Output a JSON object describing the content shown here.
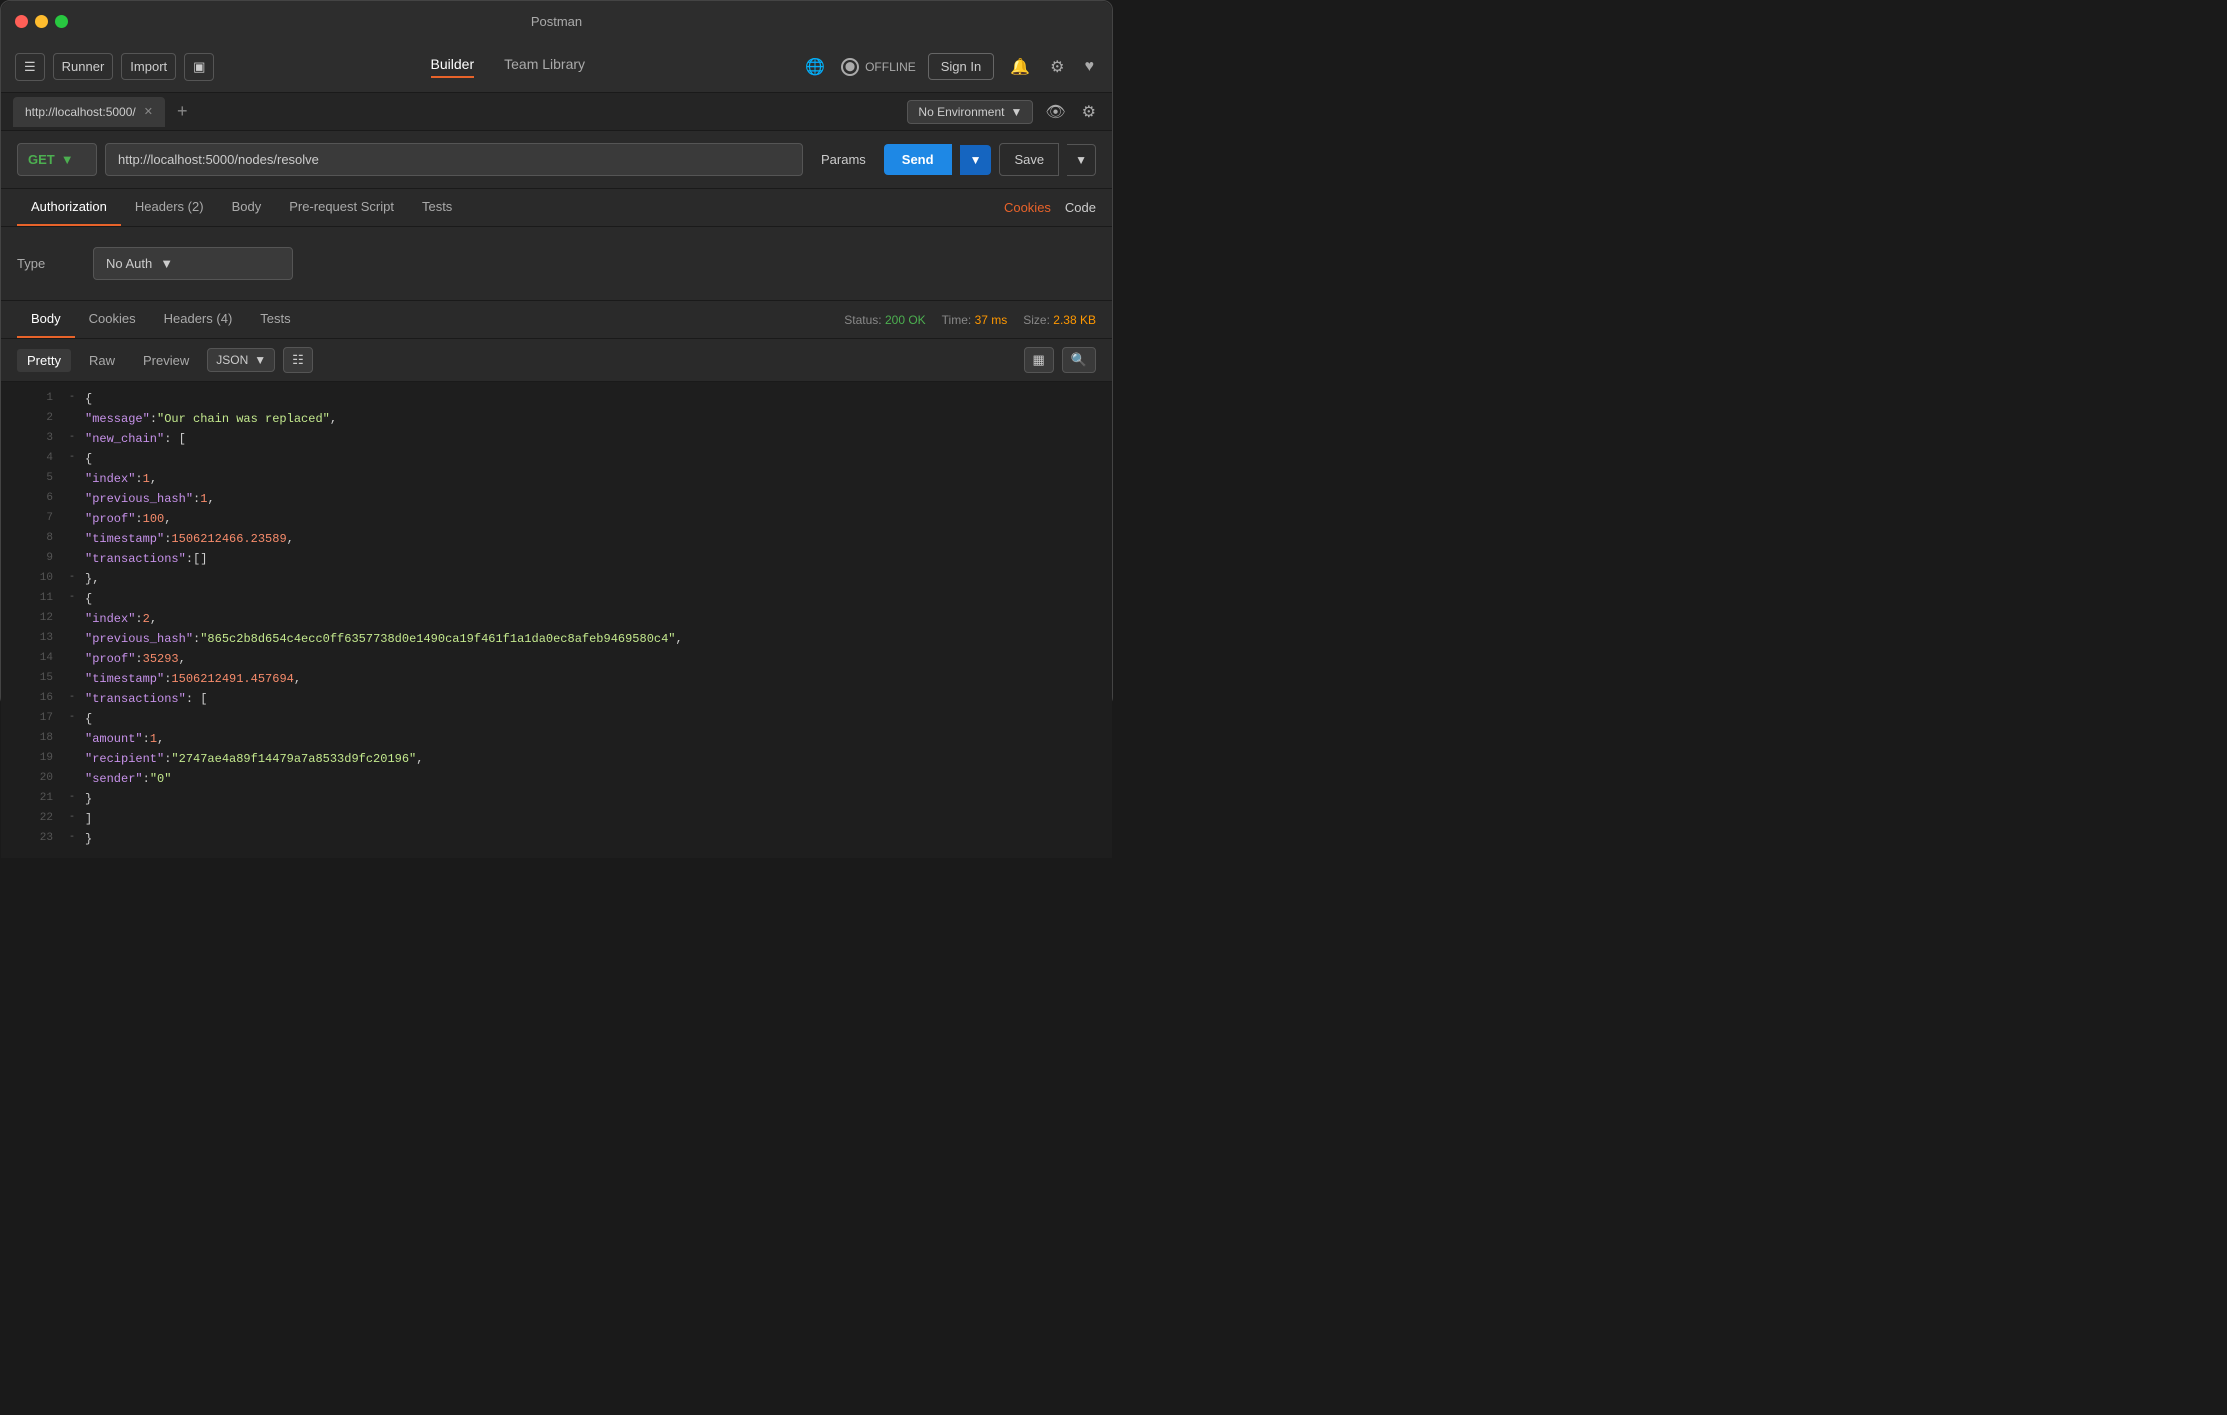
{
  "titlebar": {
    "title": "Postman"
  },
  "toolbar": {
    "runner_label": "Runner",
    "import_label": "Import",
    "builder_tab": "Builder",
    "team_library_tab": "Team Library",
    "offline_label": "OFFLINE",
    "sign_in_label": "Sign In"
  },
  "tab_bar": {
    "tab_url": "http://localhost:5000/",
    "no_environment": "No Environment",
    "chevron": "▾"
  },
  "request": {
    "method": "GET",
    "url": "http://localhost:5000/nodes/resolve",
    "params_label": "Params",
    "send_label": "Send",
    "save_label": "Save"
  },
  "req_tabs": {
    "authorization": "Authorization",
    "headers": "Headers",
    "headers_count": "2",
    "body": "Body",
    "pre_request": "Pre-request Script",
    "tests": "Tests",
    "cookies": "Cookies",
    "code": "Code"
  },
  "auth": {
    "type_label": "Type",
    "no_auth": "No Auth"
  },
  "response": {
    "body_tab": "Body",
    "cookies_tab": "Cookies",
    "headers_tab": "Headers",
    "headers_count": "4",
    "tests_tab": "Tests",
    "status_label": "Status:",
    "status_value": "200 OK",
    "time_label": "Time:",
    "time_value": "37 ms",
    "size_label": "Size:",
    "size_value": "2.38 KB",
    "pretty_tab": "Pretty",
    "raw_tab": "Raw",
    "preview_tab": "Preview",
    "format": "JSON"
  },
  "json_lines": [
    {
      "num": 1,
      "collapse": "-",
      "content": [
        {
          "type": "brace",
          "text": "{"
        }
      ]
    },
    {
      "num": 2,
      "collapse": "",
      "content": [
        {
          "type": "key",
          "text": "  \"message\""
        },
        {
          "type": "punct",
          "text": ": "
        },
        {
          "type": "str",
          "text": "\"Our chain was replaced\""
        },
        {
          "type": "punct",
          "text": ","
        }
      ]
    },
    {
      "num": 3,
      "collapse": "-",
      "content": [
        {
          "type": "key",
          "text": "  \"new_chain\""
        },
        {
          "type": "punct",
          "text": ": ["
        },
        {
          "type": "brace",
          "text": ""
        }
      ]
    },
    {
      "num": 4,
      "collapse": "-",
      "content": [
        {
          "type": "brace",
          "text": "    {"
        }
      ]
    },
    {
      "num": 5,
      "collapse": "",
      "content": [
        {
          "type": "key",
          "text": "      \"index\""
        },
        {
          "type": "punct",
          "text": ": "
        },
        {
          "type": "num",
          "text": "1"
        },
        {
          "type": "punct",
          "text": ","
        }
      ]
    },
    {
      "num": 6,
      "collapse": "",
      "content": [
        {
          "type": "key",
          "text": "      \"previous_hash\""
        },
        {
          "type": "punct",
          "text": ": "
        },
        {
          "type": "num",
          "text": "1"
        },
        {
          "type": "punct",
          "text": ","
        }
      ]
    },
    {
      "num": 7,
      "collapse": "",
      "content": [
        {
          "type": "key",
          "text": "      \"proof\""
        },
        {
          "type": "punct",
          "text": ": "
        },
        {
          "type": "num",
          "text": "100"
        },
        {
          "type": "punct",
          "text": ","
        }
      ]
    },
    {
      "num": 8,
      "collapse": "",
      "content": [
        {
          "type": "key",
          "text": "      \"timestamp\""
        },
        {
          "type": "punct",
          "text": ": "
        },
        {
          "type": "num",
          "text": "1506212466.23589"
        },
        {
          "type": "punct",
          "text": ","
        }
      ]
    },
    {
      "num": 9,
      "collapse": "",
      "content": [
        {
          "type": "key",
          "text": "      \"transactions\""
        },
        {
          "type": "punct",
          "text": ": "
        },
        {
          "type": "brace",
          "text": "[]"
        }
      ]
    },
    {
      "num": 10,
      "collapse": "-",
      "content": [
        {
          "type": "brace",
          "text": "    },"
        }
      ]
    },
    {
      "num": 11,
      "collapse": "-",
      "content": [
        {
          "type": "brace",
          "text": "    {"
        }
      ]
    },
    {
      "num": 12,
      "collapse": "",
      "content": [
        {
          "type": "key",
          "text": "      \"index\""
        },
        {
          "type": "punct",
          "text": ": "
        },
        {
          "type": "num",
          "text": "2"
        },
        {
          "type": "punct",
          "text": ","
        }
      ]
    },
    {
      "num": 13,
      "collapse": "",
      "content": [
        {
          "type": "key",
          "text": "      \"previous_hash\""
        },
        {
          "type": "punct",
          "text": ": "
        },
        {
          "type": "str",
          "text": "\"865c2b8d654c4ecc0ff6357738d0e1490ca19f461f1a1da0ec8afeb9469580c4\""
        },
        {
          "type": "punct",
          "text": ","
        }
      ]
    },
    {
      "num": 14,
      "collapse": "",
      "content": [
        {
          "type": "key",
          "text": "      \"proof\""
        },
        {
          "type": "punct",
          "text": ": "
        },
        {
          "type": "num",
          "text": "35293"
        },
        {
          "type": "punct",
          "text": ","
        }
      ]
    },
    {
      "num": 15,
      "collapse": "",
      "content": [
        {
          "type": "key",
          "text": "      \"timestamp\""
        },
        {
          "type": "punct",
          "text": ": "
        },
        {
          "type": "num",
          "text": "1506212491.457694"
        },
        {
          "type": "punct",
          "text": ","
        }
      ]
    },
    {
      "num": 16,
      "collapse": "-",
      "content": [
        {
          "type": "key",
          "text": "      \"transactions\""
        },
        {
          "type": "punct",
          "text": ": ["
        },
        {
          "type": "brace",
          "text": ""
        }
      ]
    },
    {
      "num": 17,
      "collapse": "-",
      "content": [
        {
          "type": "brace",
          "text": "        {"
        }
      ]
    },
    {
      "num": 18,
      "collapse": "",
      "content": [
        {
          "type": "key",
          "text": "          \"amount\""
        },
        {
          "type": "punct",
          "text": ": "
        },
        {
          "type": "num",
          "text": "1"
        },
        {
          "type": "punct",
          "text": ","
        }
      ]
    },
    {
      "num": 19,
      "collapse": "",
      "content": [
        {
          "type": "key",
          "text": "          \"recipient\""
        },
        {
          "type": "punct",
          "text": ": "
        },
        {
          "type": "str",
          "text": "\"2747ae4a89f14479a7a8533d9fc20196\""
        },
        {
          "type": "punct",
          "text": ","
        }
      ]
    },
    {
      "num": 20,
      "collapse": "",
      "content": [
        {
          "type": "key",
          "text": "          \"sender\""
        },
        {
          "type": "punct",
          "text": ": "
        },
        {
          "type": "str",
          "text": "\"0\""
        }
      ]
    },
    {
      "num": 21,
      "collapse": "-",
      "content": [
        {
          "type": "brace",
          "text": "        }"
        }
      ]
    },
    {
      "num": 22,
      "collapse": "-",
      "content": [
        {
          "type": "brace",
          "text": "      ]"
        }
      ]
    },
    {
      "num": 23,
      "collapse": "-",
      "content": [
        {
          "type": "brace",
          "text": "    }"
        }
      ]
    }
  ]
}
